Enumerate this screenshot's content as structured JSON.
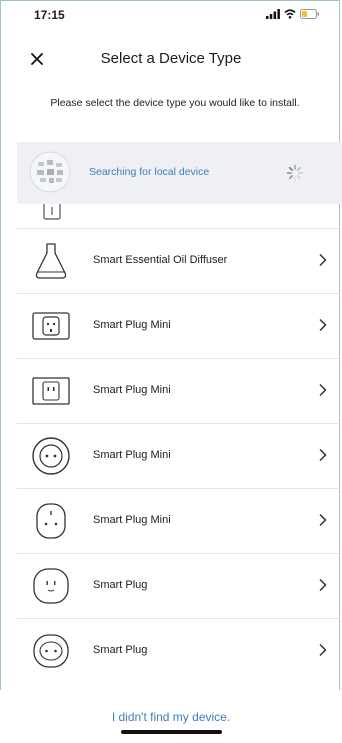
{
  "status_bar": {
    "time": "17:15"
  },
  "header": {
    "title": "Select a Device Type",
    "close_icon": "close-icon"
  },
  "instructions": "Please select the device type you would like to install.",
  "search": {
    "text": "Searching for local device",
    "icon": "loading-spinner-icon"
  },
  "devices": [
    {
      "label": "Smart Essential Oil Diffuser",
      "icon": "diffuser-icon"
    },
    {
      "label": "Smart Plug Mini",
      "icon": "plug-mini-square-icon"
    },
    {
      "label": "Smart Plug Mini",
      "icon": "plug-mini-square-icon"
    },
    {
      "label": "Smart Plug Mini",
      "icon": "plug-round-icon"
    },
    {
      "label": "Smart Plug Mini",
      "icon": "plug-mini-rounded-icon"
    },
    {
      "label": "Smart Plug",
      "icon": "plug-rounded-icon"
    },
    {
      "label": "Smart Plug",
      "icon": "plug-round-icon"
    }
  ],
  "footer": {
    "link": "I didn't find my device."
  },
  "colors": {
    "accent": "#3e7cc0",
    "search_bg": "#eef0f4",
    "divider": "#e6e6e6"
  }
}
